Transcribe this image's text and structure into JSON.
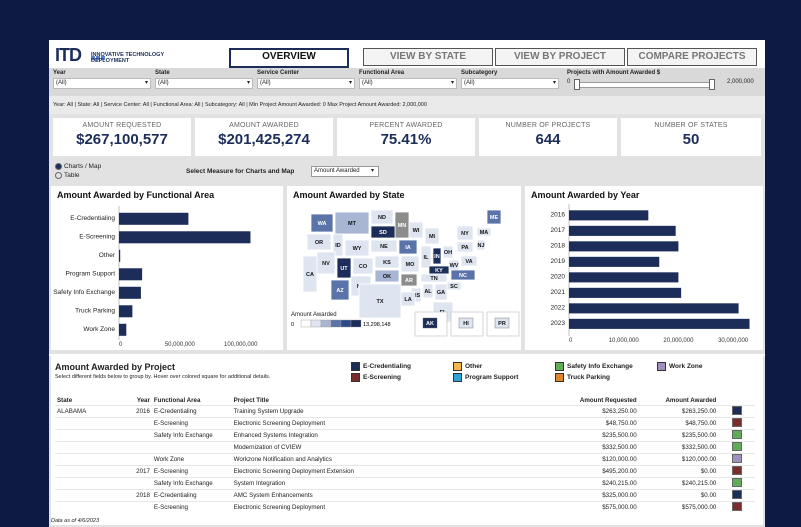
{
  "logo": {
    "letters": "ITD",
    "line1": "INNOVATIVE TECHNOLOGY",
    "line2": "DEPLOYMENT"
  },
  "tabs": [
    "OVERVIEW",
    "VIEW BY STATE",
    "VIEW BY PROJECT",
    "COMPARE PROJECTS"
  ],
  "filters": [
    {
      "label": "Year",
      "value": "(All)"
    },
    {
      "label": "State",
      "value": "(All)"
    },
    {
      "label": "Service Center",
      "value": "(All)"
    },
    {
      "label": "Functional Area",
      "value": "(All)"
    },
    {
      "label": "Subcategory",
      "value": "(All)"
    }
  ],
  "slider": {
    "label": "Projects with Amount Awarded $",
    "min": "0",
    "max": "2,000,000"
  },
  "summary": "Year: All | State: All | Service Center: All | Functional Area: All | Subcategory: All | Min Project Amount Awarded: 0  Max Project Amount Awarded: 2,000,000",
  "kpis": [
    {
      "label": "AMOUNT REQUESTED",
      "value": "$267,100,577"
    },
    {
      "label": "AMOUNT AWARDED",
      "value": "$201,425,274"
    },
    {
      "label": "PERCENT AWARDED",
      "value": "75.41%"
    },
    {
      "label": "NUMBER OF PROJECTS",
      "value": "644"
    },
    {
      "label": "NUMBER OF STATES",
      "value": "50"
    }
  ],
  "view_options": [
    "Charts / Map",
    "Table"
  ],
  "measure": {
    "label": "Select Measure for Charts and Map",
    "value": "Amount Awarded"
  },
  "panels": {
    "functional": "Amount Awarded by Functional Area",
    "state": "Amount Awarded by State",
    "year": "Amount Awarded by Year"
  },
  "map": {
    "legend_title": "Amount Awarded",
    "legend_min": "0",
    "legend_max": "13,298,148",
    "insets": [
      "AK",
      "HI",
      "PR"
    ],
    "states": [
      "WA",
      "MT",
      "ND",
      "MN",
      "OR",
      "ID",
      "SD",
      "WI",
      "MI",
      "NY",
      "ME",
      "WY",
      "NE",
      "IA",
      "PA",
      "MA",
      "NV",
      "UT",
      "CO",
      "KS",
      "MO",
      "IL",
      "IN",
      "OH",
      "WV",
      "VA",
      "NJ",
      "CA",
      "KY",
      "NC",
      "AZ",
      "NM",
      "OK",
      "AR",
      "TN",
      "SC",
      "MS",
      "AL",
      "GA",
      "TX",
      "LA",
      "FL"
    ]
  },
  "project_section": {
    "title": "Amount Awarded by Project",
    "subtitle": "Select different fields below to group by. Hover over colored square for additional details."
  },
  "legend": [
    {
      "name": "E-Credentialing",
      "color": "#1c2d5a"
    },
    {
      "name": "E-Screening",
      "color": "#7b2d2d"
    },
    {
      "name": "Other",
      "color": "#f5b74a"
    },
    {
      "name": "Program Support",
      "color": "#2ea3d6"
    },
    {
      "name": "Safety Info Exchange",
      "color": "#5fae57"
    },
    {
      "name": "Truck Parking",
      "color": "#e0852e"
    },
    {
      "name": "Work Zone",
      "color": "#a08fbf"
    }
  ],
  "table_headers": [
    "State",
    "Year",
    "Functional Area",
    "Project Title",
    "Amount Requested",
    "Amount Awarded"
  ],
  "table_rows": [
    {
      "state": "ALABAMA",
      "year": "2016",
      "area": "E-Credentialing",
      "title": "Training System Upgrade",
      "req": "$263,250.00",
      "awd": "$263,250.00",
      "color": "#1c2d5a"
    },
    {
      "state": "",
      "year": "",
      "area": "E-Screening",
      "title": "Electronic Screening Deployment",
      "req": "$48,750.00",
      "awd": "$48,750.00",
      "color": "#7b2d2d"
    },
    {
      "state": "",
      "year": "",
      "area": "Safety Info Exchange",
      "title": "Enhanced Systems Integration",
      "req": "$235,500.00",
      "awd": "$235,500.00",
      "color": "#5fae57"
    },
    {
      "state": "",
      "year": "",
      "area": "",
      "title": "Modernization of CVIEW",
      "req": "$332,500.00",
      "awd": "$332,500.00",
      "color": "#5fae57"
    },
    {
      "state": "",
      "year": "",
      "area": "Work Zone",
      "title": "Workzone Notification and Analytics",
      "req": "$120,000.00",
      "awd": "$120,000.00",
      "color": "#a08fbf"
    },
    {
      "state": "",
      "year": "2017",
      "area": "E-Screening",
      "title": "Electronic Screening Deployment Extension",
      "req": "$495,200.00",
      "awd": "$0.00",
      "color": "#7b2d2d"
    },
    {
      "state": "",
      "year": "",
      "area": "Safety Info Exchange",
      "title": "System Integration",
      "req": "$240,215.00",
      "awd": "$240,215.00",
      "color": "#5fae57"
    },
    {
      "state": "",
      "year": "2018",
      "area": "E-Credentialing",
      "title": "AMC System Enhancements",
      "req": "$325,000.00",
      "awd": "$0.00",
      "color": "#1c2d5a"
    },
    {
      "state": "",
      "year": "",
      "area": "E-Screening",
      "title": "Electronic Screening Deployment",
      "req": "$575,000.00",
      "awd": "$575,000.00",
      "color": "#7b2d2d"
    }
  ],
  "footer": "Data as of 4/6/2023",
  "chart_data": [
    {
      "type": "bar",
      "title": "Amount Awarded by Functional Area",
      "categories": [
        "E-Credentialing",
        "E-Screening",
        "Other",
        "Program Support",
        "Safety Info Exchange",
        "Truck Parking",
        "Work Zone"
      ],
      "values": [
        57000000,
        108000000,
        1000000,
        19000000,
        18000000,
        11000000,
        6000000
      ],
      "xticks": [
        "0",
        "50,000,000",
        "100,000,000"
      ],
      "xlim": [
        0,
        115000000
      ],
      "color": "#1c2d5a"
    },
    {
      "type": "bar",
      "title": "Amount Awarded by Year",
      "categories": [
        "2016",
        "2017",
        "2018",
        "2019",
        "2020",
        "2021",
        "2022",
        "2023"
      ],
      "values": [
        14500000,
        19500000,
        20000000,
        16500000,
        20000000,
        20500000,
        31000000,
        33000000
      ],
      "xticks": [
        "0",
        "10,000,000",
        "20,000,000",
        "30,000,000"
      ],
      "xlim": [
        0,
        34000000
      ],
      "color": "#1c2d5a"
    }
  ]
}
